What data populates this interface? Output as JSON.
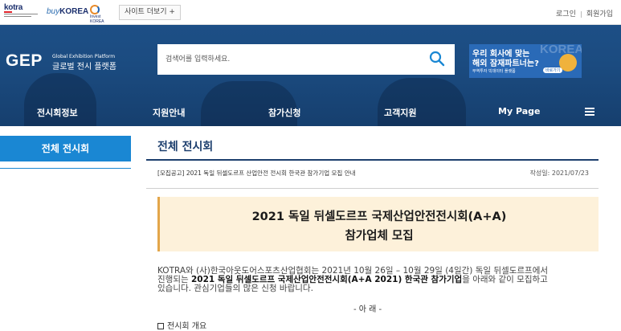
{
  "topbar": {
    "logo_kotra": "kotra",
    "logo_buykorea_prefix": "buy",
    "logo_buykorea_suffix": "KOREA",
    "logo_invest": "Invest KOREA",
    "site_more": "사이트 더보기 +",
    "login": "로그인",
    "signup": "회원가입"
  },
  "header": {
    "logo_main": "GEP",
    "logo_sub_en": "Global Exhibition Platform",
    "logo_sub_ko": "글로벌 전시 플랫폼",
    "search_placeholder": "검색어를 입력하세요.",
    "banner": {
      "line1": "우리 회사에 맞는",
      "line2": "해외 잠재파트너는?",
      "line3": "무역투자 빅데이터 플랫폼",
      "pill": "바로가기",
      "bg_text": "KOREA"
    },
    "nav": [
      "전시회정보",
      "지원안내",
      "참가신청",
      "고객지원",
      "My Page"
    ]
  },
  "sidebar": {
    "active_item": "전체 전시회"
  },
  "main": {
    "page_title": "전체 전시회",
    "notice_title": "[모집공고] 2021 독일 뒤셀도르프 산업안전 전시회 한국관 참가기업 모집 안내",
    "notice_date": "작성일: 2021/07/23",
    "hero_line1": "2021 독일 뒤셀도르프 국제산업안전전시회(A+A)",
    "hero_line2": "참가업체 모집",
    "body_line1": "KOTRA와 (사)한국아웃도어스포츠산업협회는 2021년 10월 26일 – 10월 29일 (4일간) 독일 뒤셀도르프에서",
    "body_line2": "진행되는",
    "body_strong": "2021 독일 뒤셀도르프 국제산업안전전시회(A+A 2021) 한국관 참가기업",
    "body_line2_tail": "을 아래와 같이 모집하고",
    "body_line3": "있습니다. 관심기업들의 많은 신청 바랍니다.",
    "center_mark": "- 아 래 -",
    "section_title": "전시회 개요"
  },
  "colors": {
    "header_blue": "#1b4b80",
    "sidebar_active": "#1a87d3",
    "title_navy": "#1d3f6e",
    "hero_bg": "#fdf1da"
  }
}
